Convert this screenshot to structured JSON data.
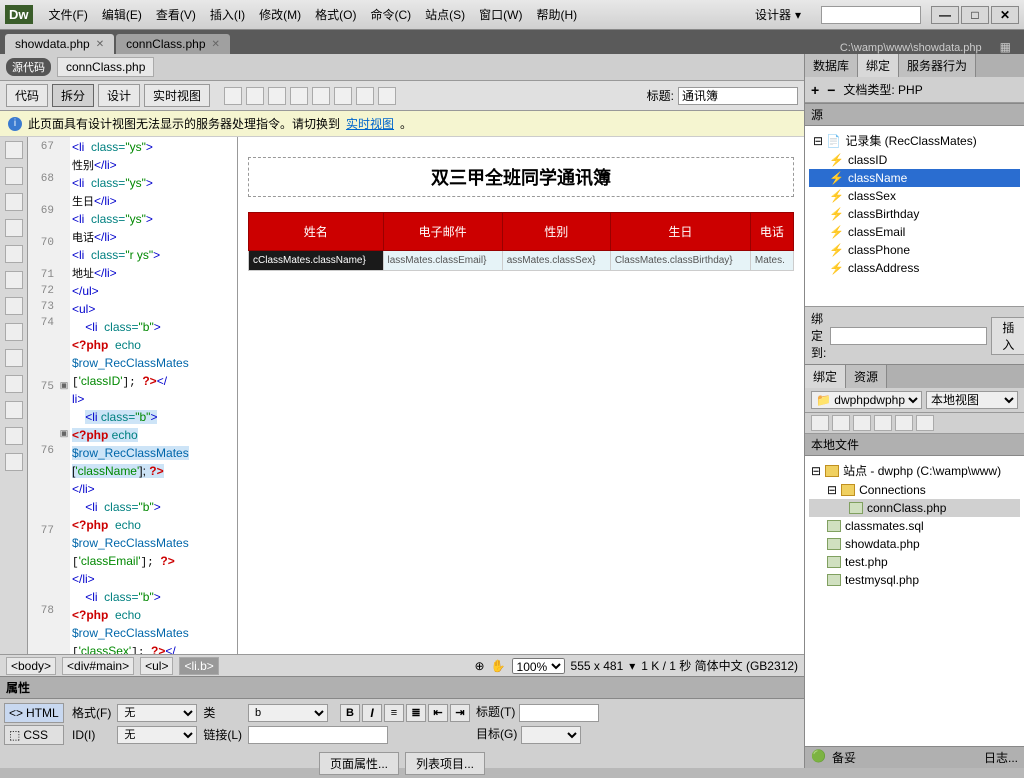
{
  "titlebar": {
    "logo": "Dw",
    "menu": [
      "文件(F)",
      "编辑(E)",
      "查看(V)",
      "插入(I)",
      "修改(M)",
      "格式(O)",
      "命令(C)",
      "站点(S)",
      "窗口(W)",
      "帮助(H)"
    ],
    "designer": "设计器"
  },
  "tabs": [
    {
      "label": "showdata.php",
      "active": true
    },
    {
      "label": "connClass.php",
      "active": false
    }
  ],
  "doc_path": "C:\\wamp\\www\\showdata.php",
  "subtab": {
    "source": "源代码",
    "file": "connClass.php"
  },
  "viewbar": {
    "buttons": [
      "代码",
      "拆分",
      "设计",
      "实时视图"
    ],
    "title_label": "标题:",
    "title_value": "通讯簿"
  },
  "warning": {
    "text": "此页面具有设计视图无法显示的服务器处理指令。请切换到",
    "link": "实时视图",
    "suffix": "。"
  },
  "code_lines": [
    67,
    68,
    69,
    70,
    71,
    72,
    73,
    74,
    75,
    76,
    77,
    78
  ],
  "design": {
    "heading": "双三甲全班同学通讯簿",
    "headers": [
      "姓名",
      "电子邮件",
      "性别",
      "生日",
      "电话"
    ],
    "row": [
      "cClassMates.className}",
      "lassMates.classEmail}",
      "assMates.classSex}",
      "ClassMates.classBirthday}",
      "Mates."
    ]
  },
  "breadcrumbs": [
    "<body>",
    "<div#main>",
    "<ul>",
    "<li.b>"
  ],
  "status_right": {
    "zoom": "100%",
    "dims": "555 x 481",
    "info": "1 K / 1 秒 简体中文 (GB2312)"
  },
  "properties": {
    "title": "属性",
    "html": "HTML",
    "css": "CSS",
    "format_l": "格式(F)",
    "format_v": "无",
    "class_l": "类",
    "class_v": "b",
    "id_l": "ID(I)",
    "id_v": "无",
    "link_l": "链接(L)",
    "link_v": "",
    "title2_l": "标题(T)",
    "target_l": "目标(G)",
    "page_props": "页面属性...",
    "list_item": "列表项目..."
  },
  "right": {
    "tabs": [
      "数据库",
      "绑定",
      "服务器行为"
    ],
    "doc_type_label": "文档类型: PHP",
    "source_title": "源",
    "recordset": "记录集 (RecClassMates)",
    "fields": [
      "classID",
      "className",
      "classSex",
      "classBirthday",
      "classEmail",
      "classPhone",
      "classAddress"
    ],
    "selected_field": "className",
    "bind_label": "绑定到:",
    "insert_btn": "插入",
    "file_tabs": [
      "绑定",
      "资源"
    ],
    "site_select": "dwphp",
    "view_select": "本地视图",
    "file_header": "本地文件",
    "site_root": "站点 - dwphp (C:\\wamp\\www)",
    "conn_folder": "Connections",
    "files": [
      "connClass.php",
      "classmates.sql",
      "showdata.php",
      "test.php",
      "testmysql.php"
    ],
    "ready": "备妥",
    "log": "日志..."
  }
}
